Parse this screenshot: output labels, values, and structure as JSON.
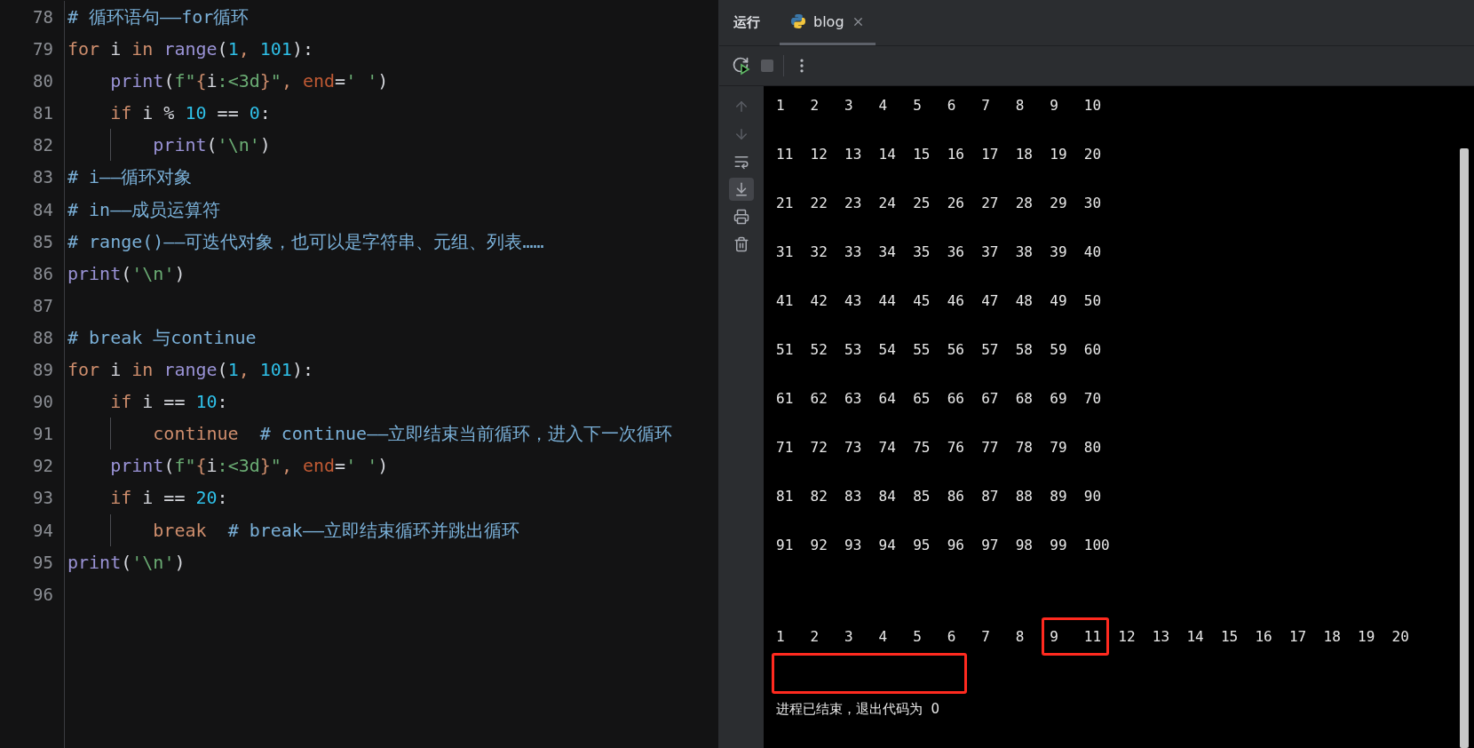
{
  "editor": {
    "lines": [
      {
        "number": "78",
        "guide": false,
        "tokens": [
          {
            "kind": "comment",
            "text": "# 循环语句——for循环"
          }
        ]
      },
      {
        "number": "79",
        "guide": false,
        "tokens": [
          {
            "kind": "kw",
            "text": "for"
          },
          {
            "kind": "plain",
            "text": " i "
          },
          {
            "kind": "kw",
            "text": "in "
          },
          {
            "kind": "builtin",
            "text": "range"
          },
          {
            "kind": "plain",
            "text": "("
          },
          {
            "kind": "num",
            "text": "1"
          },
          {
            "kind": "kw",
            "text": ", "
          },
          {
            "kind": "num",
            "text": "101"
          },
          {
            "kind": "plain",
            "text": "):"
          }
        ]
      },
      {
        "number": "80",
        "guide": false,
        "tokens": [
          {
            "kind": "builtin",
            "text": "    print"
          },
          {
            "kind": "plain",
            "text": "("
          },
          {
            "kind": "str",
            "text": "f\""
          },
          {
            "kind": "kw",
            "text": "{"
          },
          {
            "kind": "plain",
            "text": "i"
          },
          {
            "kind": "str",
            "text": ":<3d"
          },
          {
            "kind": "kw",
            "text": "}"
          },
          {
            "kind": "str",
            "text": "\""
          },
          {
            "kind": "kw",
            "text": ", "
          },
          {
            "kind": "param",
            "text": "end"
          },
          {
            "kind": "plain",
            "text": "="
          },
          {
            "kind": "str",
            "text": "' '"
          },
          {
            "kind": "plain",
            "text": ")"
          }
        ]
      },
      {
        "number": "81",
        "guide": false,
        "tokens": [
          {
            "kind": "kw",
            "text": "    if"
          },
          {
            "kind": "plain",
            "text": " i % "
          },
          {
            "kind": "num",
            "text": "10"
          },
          {
            "kind": "plain",
            "text": " == "
          },
          {
            "kind": "num",
            "text": "0"
          },
          {
            "kind": "plain",
            "text": ":"
          }
        ]
      },
      {
        "number": "82",
        "guide": true,
        "tokens": [
          {
            "kind": "builtin",
            "text": "        print"
          },
          {
            "kind": "plain",
            "text": "("
          },
          {
            "kind": "str",
            "text": "'\\n'"
          },
          {
            "kind": "plain",
            "text": ")"
          }
        ]
      },
      {
        "number": "83",
        "guide": false,
        "tokens": [
          {
            "kind": "comment",
            "text": "# i——循环对象"
          }
        ]
      },
      {
        "number": "84",
        "guide": false,
        "tokens": [
          {
            "kind": "comment",
            "text": "# in——成员运算符"
          }
        ]
      },
      {
        "number": "85",
        "guide": false,
        "tokens": [
          {
            "kind": "comment",
            "text": "# range()——可迭代对象，也可以是字符串、元组、列表……"
          }
        ]
      },
      {
        "number": "86",
        "guide": false,
        "tokens": [
          {
            "kind": "builtin",
            "text": "print"
          },
          {
            "kind": "plain",
            "text": "("
          },
          {
            "kind": "str",
            "text": "'\\n'"
          },
          {
            "kind": "plain",
            "text": ")"
          }
        ]
      },
      {
        "number": "87",
        "guide": false
      },
      {
        "number": "88",
        "guide": false,
        "tokens": [
          {
            "kind": "comment",
            "text": "# break 与continue"
          }
        ]
      },
      {
        "number": "89",
        "guide": false,
        "tokens": [
          {
            "kind": "kw",
            "text": "for"
          },
          {
            "kind": "plain",
            "text": " i "
          },
          {
            "kind": "kw",
            "text": "in "
          },
          {
            "kind": "builtin",
            "text": "range"
          },
          {
            "kind": "plain",
            "text": "("
          },
          {
            "kind": "num",
            "text": "1"
          },
          {
            "kind": "kw",
            "text": ", "
          },
          {
            "kind": "num",
            "text": "101"
          },
          {
            "kind": "plain",
            "text": "):"
          }
        ]
      },
      {
        "number": "90",
        "guide": false,
        "tokens": [
          {
            "kind": "kw",
            "text": "    if"
          },
          {
            "kind": "plain",
            "text": " i == "
          },
          {
            "kind": "num",
            "text": "10"
          },
          {
            "kind": "plain",
            "text": ":"
          }
        ]
      },
      {
        "number": "91",
        "guide": true,
        "tokens": [
          {
            "kind": "kw",
            "text": "        continue  "
          },
          {
            "kind": "comment",
            "text": "# continue——立即结束当前循环，进入下一次循环"
          }
        ]
      },
      {
        "number": "92",
        "guide": false,
        "tokens": [
          {
            "kind": "builtin",
            "text": "    print"
          },
          {
            "kind": "plain",
            "text": "("
          },
          {
            "kind": "str",
            "text": "f\""
          },
          {
            "kind": "kw",
            "text": "{"
          },
          {
            "kind": "plain",
            "text": "i"
          },
          {
            "kind": "str",
            "text": ":<3d"
          },
          {
            "kind": "kw",
            "text": "}"
          },
          {
            "kind": "str",
            "text": "\""
          },
          {
            "kind": "kw",
            "text": ", "
          },
          {
            "kind": "param",
            "text": "end"
          },
          {
            "kind": "plain",
            "text": "="
          },
          {
            "kind": "str",
            "text": "' '"
          },
          {
            "kind": "plain",
            "text": ")"
          }
        ]
      },
      {
        "number": "93",
        "guide": false,
        "tokens": [
          {
            "kind": "kw",
            "text": "    if"
          },
          {
            "kind": "plain",
            "text": " i == "
          },
          {
            "kind": "num",
            "text": "20"
          },
          {
            "kind": "plain",
            "text": ":"
          }
        ]
      },
      {
        "number": "94",
        "guide": true,
        "tokens": [
          {
            "kind": "kw",
            "text": "        break  "
          },
          {
            "kind": "comment",
            "text": "# break——立即结束循环并跳出循环"
          }
        ]
      },
      {
        "number": "95",
        "guide": false,
        "tokens": [
          {
            "kind": "builtin",
            "text": "print"
          },
          {
            "kind": "plain",
            "text": "("
          },
          {
            "kind": "str",
            "text": "'\\n'"
          },
          {
            "kind": "plain",
            "text": ")"
          }
        ]
      },
      {
        "number": "96",
        "guide": false
      }
    ]
  },
  "run_panel": {
    "title": "运行",
    "tabs": [
      {
        "label": "blog",
        "selected": true
      }
    ],
    "side_tools": [
      {
        "kind": "up",
        "disabled": true,
        "selected": false
      },
      {
        "kind": "down",
        "disabled": true,
        "selected": false
      },
      {
        "kind": "wrap",
        "disabled": false,
        "selected": false
      },
      {
        "kind": "scroll_end",
        "disabled": false,
        "selected": true
      },
      {
        "kind": "print",
        "disabled": false,
        "selected": false
      },
      {
        "kind": "clear",
        "disabled": false,
        "selected": false
      }
    ],
    "console": {
      "rows": [
        "1   2   3   4   5   6   7   8   9   10",
        "11  12  13  14  15  16  17  18  19  20",
        "21  22  23  24  25  26  27  28  29  30",
        "31  32  33  34  35  36  37  38  39  40",
        "41  42  43  44  45  46  47  48  49  50",
        "51  52  53  54  55  56  57  58  59  60",
        "61  62  63  64  65  66  67  68  69  70",
        "71  72  73  74  75  76  77  78  79  80",
        "81  82  83  84  85  86  87  88  89  90",
        "91  92  93  94  95  96  97  98  99  100"
      ],
      "final_row": [
        {
          "text": "1   2   3   4   5   6   7   8   ",
          "highlighted": false
        },
        {
          "text": "9   11",
          "highlighted": true
        },
        {
          "text": "  12  13  14  15  16  17  18  19  20",
          "highlighted": false
        }
      ],
      "marked_empty_line": true,
      "status": "进程已结束，退出代码为  0"
    }
  }
}
